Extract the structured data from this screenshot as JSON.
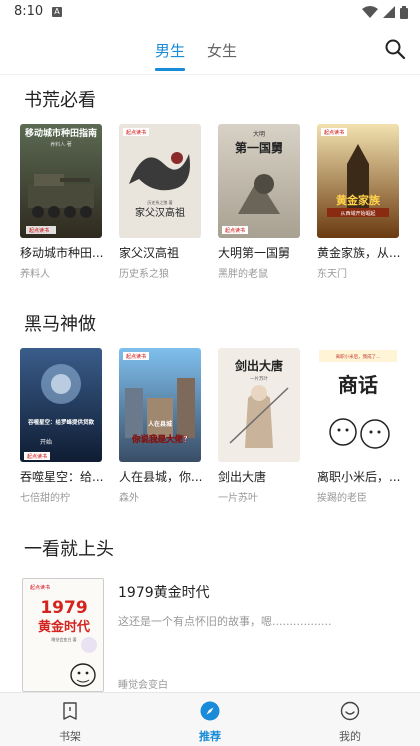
{
  "status_bar": {
    "time": "8:10",
    "notif": "A"
  },
  "tabs": [
    {
      "label": "男生",
      "active": true
    },
    {
      "label": "女生",
      "active": false
    }
  ],
  "sections": [
    {
      "title": "书荒必看",
      "books": [
        {
          "title": "移动城市种田...",
          "author": "养料人",
          "cover_text": "移动城市种田指南",
          "cover_sub": "养料人·著"
        },
        {
          "title": "家父汉高祖",
          "author": "历史系之狼",
          "cover_text": "家父汉高祖",
          "cover_sub": "历史系之狼 著"
        },
        {
          "title": "大明第一国舅",
          "author": "黑胖的老鼠",
          "cover_text": "第一国舅",
          "cover_sub": "大明"
        },
        {
          "title": "黄金家族，从...",
          "author": "东天门",
          "cover_text": "黄金家族",
          "cover_sub": "从西域开始崛起"
        }
      ]
    },
    {
      "title": "黑马神做",
      "books": [
        {
          "title": "吞噬星空：给...",
          "author": "七倍甜的柠",
          "cover_text": "吞噬星空：给罗峰提供贷款",
          "cover_sub": "开始"
        },
        {
          "title": "人在县城，你...",
          "author": "森外",
          "cover_text": "你说我是大佬?",
          "cover_sub": "人在县城"
        },
        {
          "title": "剑出大唐",
          "author": "一片苏叶",
          "cover_text": "剑出大唐",
          "cover_sub": "一片苏叶"
        },
        {
          "title": "离职小米后，...",
          "author": "挨踢的老臣",
          "cover_text": "商话",
          "cover_sub": "离职小米后，我成了..."
        }
      ]
    }
  ],
  "featured_section": {
    "title": "一看就上头",
    "book": {
      "title": "1979黄金时代",
      "description": "这还是一个有点怀旧的故事，嗯.................",
      "author": "睡觉会变白",
      "cover_text_1": "1979",
      "cover_text_2": "黄金时代",
      "cover_sub": "睡觉会变白 著"
    }
  },
  "bottom_nav": [
    {
      "label": "书架",
      "icon": "bookshelf-icon",
      "active": false
    },
    {
      "label": "推荐",
      "icon": "compass-icon",
      "active": true
    },
    {
      "label": "我的",
      "icon": "smiley-icon",
      "active": false
    }
  ],
  "publisher_badge": "起点读书",
  "colors": {
    "accent": "#1a8bd8",
    "text": "#222222",
    "muted": "#999999",
    "nav_bg": "#f7f7f7"
  }
}
